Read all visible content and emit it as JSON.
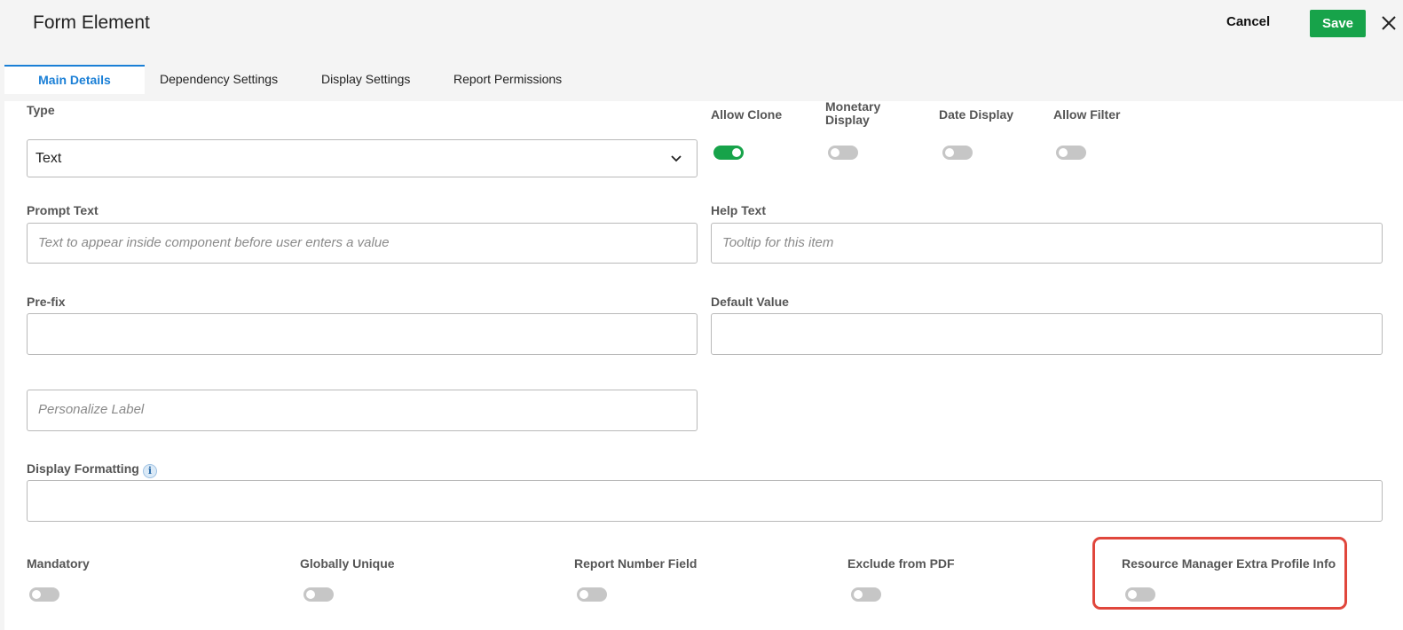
{
  "header": {
    "title": "Form Element",
    "cancel_label": "Cancel",
    "save_label": "Save",
    "close_icon": "close-icon"
  },
  "colors": {
    "accent": "#1a7fd6",
    "save": "#17a34a",
    "toggle_on": "#17a34a",
    "highlight": "#e0463c"
  },
  "tabs": [
    {
      "label": "Main Details",
      "active": true
    },
    {
      "label": "Dependency Settings",
      "active": false
    },
    {
      "label": "Display Settings",
      "active": false
    },
    {
      "label": "Report Permissions",
      "active": false
    }
  ],
  "form": {
    "type": {
      "label": "Type",
      "value": "Text"
    },
    "flags": [
      {
        "label": "Allow Clone",
        "on": true
      },
      {
        "label": "Monetary Display",
        "on": false
      },
      {
        "label": "Date Display",
        "on": false
      },
      {
        "label": "Allow Filter",
        "on": false
      }
    ],
    "prompt_text": {
      "label": "Prompt Text",
      "placeholder": "Text to appear inside component before user enters a value"
    },
    "help_text": {
      "label": "Help Text",
      "placeholder": "Tooltip for this item"
    },
    "prefix": {
      "label": "Pre-fix",
      "value": ""
    },
    "default_value": {
      "label": "Default Value",
      "value": ""
    },
    "personalize_label": {
      "placeholder": "Personalize Label"
    },
    "display_formatting": {
      "label": "Display Formatting",
      "info_icon": "i",
      "value": ""
    },
    "bottom_toggles": [
      {
        "label": "Mandatory",
        "on": false
      },
      {
        "label": "Globally Unique",
        "on": false
      },
      {
        "label": "Report Number Field",
        "on": false
      },
      {
        "label": "Exclude from PDF",
        "on": false
      },
      {
        "label": "Resource Manager Extra Profile Info",
        "on": false,
        "highlighted": true
      }
    ]
  }
}
